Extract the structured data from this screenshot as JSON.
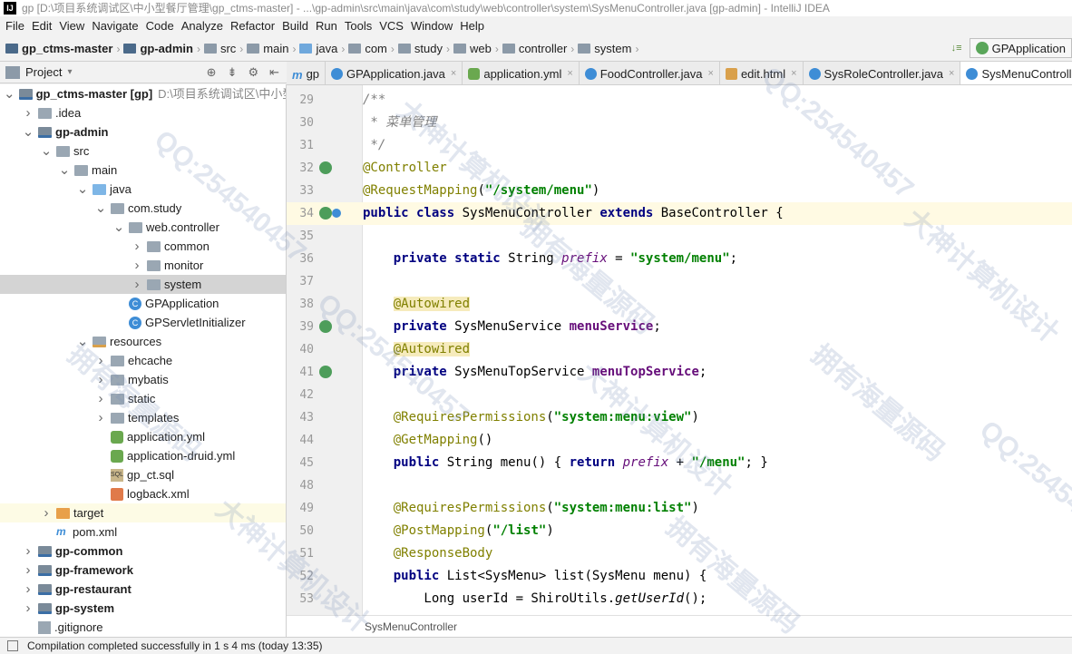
{
  "window": {
    "title": "gp [D:\\项目系统调试区\\中小型餐厅管理\\gp_ctms-master] - ...\\gp-admin\\src\\main\\java\\com\\study\\web\\controller\\system\\SysMenuController.java [gp-admin] - IntelliJ IDEA"
  },
  "menu": [
    "File",
    "Edit",
    "View",
    "Navigate",
    "Code",
    "Analyze",
    "Refactor",
    "Build",
    "Run",
    "Tools",
    "VCS",
    "Window",
    "Help"
  ],
  "breadcrumbs": [
    "gp_ctms-master",
    "gp-admin",
    "src",
    "main",
    "java",
    "com",
    "study",
    "web",
    "controller",
    "system"
  ],
  "run_config": "GPApplication",
  "project_panel": {
    "title": "Project"
  },
  "tree": [
    {
      "label": "gp_ctms-master [gp]",
      "path": "D:\\项目系统调试区\\中小型餐",
      "level": 0,
      "arrow": "▾",
      "icon": "mod",
      "bold": true
    },
    {
      "label": ".idea",
      "level": 1,
      "arrow": "▸",
      "icon": "gray"
    },
    {
      "label": "gp-admin",
      "level": 1,
      "arrow": "▾",
      "icon": "mod",
      "bold": true
    },
    {
      "label": "src",
      "level": 2,
      "arrow": "▾",
      "icon": "gray"
    },
    {
      "label": "main",
      "level": 3,
      "arrow": "▾",
      "icon": "gray"
    },
    {
      "label": "java",
      "level": 4,
      "arrow": "▾",
      "icon": "blue"
    },
    {
      "label": "com.study",
      "level": 5,
      "arrow": "▾",
      "icon": "gray"
    },
    {
      "label": "web.controller",
      "level": 6,
      "arrow": "▾",
      "icon": "gray"
    },
    {
      "label": "common",
      "level": 7,
      "arrow": "▸",
      "icon": "gray"
    },
    {
      "label": "monitor",
      "level": 7,
      "arrow": "▸",
      "icon": "gray"
    },
    {
      "label": "system",
      "level": 7,
      "arrow": "▸",
      "icon": "gray",
      "selected": true
    },
    {
      "label": "GPApplication",
      "level": 6,
      "arrow": "",
      "icon": "class"
    },
    {
      "label": "GPServletInitializer",
      "level": 6,
      "arrow": "",
      "icon": "class"
    },
    {
      "label": "resources",
      "level": 4,
      "arrow": "▾",
      "icon": "res"
    },
    {
      "label": "ehcache",
      "level": 5,
      "arrow": "▸",
      "icon": "gray"
    },
    {
      "label": "mybatis",
      "level": 5,
      "arrow": "▸",
      "icon": "gray"
    },
    {
      "label": "static",
      "level": 5,
      "arrow": "▸",
      "icon": "gray"
    },
    {
      "label": "templates",
      "level": 5,
      "arrow": "▸",
      "icon": "gray"
    },
    {
      "label": "application.yml",
      "level": 5,
      "arrow": "",
      "icon": "yml"
    },
    {
      "label": "application-druid.yml",
      "level": 5,
      "arrow": "",
      "icon": "yml"
    },
    {
      "label": "gp_ct.sql",
      "level": 5,
      "arrow": "",
      "icon": "sql"
    },
    {
      "label": "logback.xml",
      "level": 5,
      "arrow": "",
      "icon": "xml"
    },
    {
      "label": "target",
      "level": 2,
      "arrow": "▸",
      "icon": "orange",
      "highlight": true
    },
    {
      "label": "pom.xml",
      "level": 2,
      "arrow": "",
      "icon": "maven"
    },
    {
      "label": "gp-common",
      "level": 1,
      "arrow": "▸",
      "icon": "mod",
      "bold": true
    },
    {
      "label": "gp-framework",
      "level": 1,
      "arrow": "▸",
      "icon": "mod",
      "bold": true
    },
    {
      "label": "gp-restaurant",
      "level": 1,
      "arrow": "▸",
      "icon": "mod",
      "bold": true
    },
    {
      "label": "gp-system",
      "level": 1,
      "arrow": "▸",
      "icon": "mod",
      "bold": true
    },
    {
      "label": ".gitignore",
      "level": 1,
      "arrow": "",
      "icon": "file"
    }
  ],
  "tabs": [
    {
      "label": "gp",
      "icon": "m",
      "close": false
    },
    {
      "label": "GPApplication.java",
      "icon": "c",
      "close": true
    },
    {
      "label": "application.yml",
      "icon": "y",
      "close": true
    },
    {
      "label": "FoodController.java",
      "icon": "c",
      "close": true
    },
    {
      "label": "edit.html",
      "icon": "h",
      "close": true
    },
    {
      "label": "SysRoleController.java",
      "icon": "c",
      "close": true
    },
    {
      "label": "SysMenuController.java",
      "icon": "c",
      "close": true,
      "active": true
    }
  ],
  "code_lines": [
    {
      "n": "29",
      "html": "<span class=\"cmt\">/**</span>"
    },
    {
      "n": "30",
      "html": "<span class=\"cmt\"> * 菜单管理</span>"
    },
    {
      "n": "31",
      "html": "<span class=\"cmt\"> */</span>"
    },
    {
      "n": "32",
      "html": "<span class=\"ann\">@Controller</span>",
      "mark": true
    },
    {
      "n": "33",
      "html": "<span class=\"ann\">@RequestMapping</span>(<span class=\"str\">\"/system/menu\"</span>)"
    },
    {
      "n": "34",
      "html": "<span class=\"kw\">public class</span> SysMenuController <span class=\"kw\">extends</span> BaseController {",
      "mark": true,
      "mark2": true,
      "current": true
    },
    {
      "n": "35",
      "html": ""
    },
    {
      "n": "36",
      "html": "    <span class=\"kw\">private static</span> String <span class=\"italf\">prefix</span> = <span class=\"str\">\"system/menu\"</span>;"
    },
    {
      "n": "37",
      "html": ""
    },
    {
      "n": "38",
      "html": "    <span class=\"ann annbg\">@Autowired</span>"
    },
    {
      "n": "39",
      "html": "    <span class=\"kw\">private</span> SysMenuService <span class=\"fld\">menuService</span>;",
      "mark": true
    },
    {
      "n": "40",
      "html": "    <span class=\"ann annbg\">@Autowired</span>"
    },
    {
      "n": "41",
      "html": "    <span class=\"kw\">private</span> SysMenuTopService <span class=\"fld\">menuTopService</span>;",
      "mark": true
    },
    {
      "n": "42",
      "html": ""
    },
    {
      "n": "43",
      "html": "    <span class=\"ann\">@RequiresPermissions</span>(<span class=\"str\">\"system:menu:view\"</span>)"
    },
    {
      "n": "44",
      "html": "    <span class=\"ann\">@GetMapping</span>()"
    },
    {
      "n": "45",
      "html": "    <span class=\"kw\">public</span> String menu() { <span class=\"kw\">return</span> <span class=\"italf\">prefix</span> + <span class=\"str\">\"/menu\"</span>; }"
    },
    {
      "n": "48",
      "html": ""
    },
    {
      "n": "49",
      "html": "    <span class=\"ann\">@RequiresPermissions</span>(<span class=\"str\">\"system:menu:list\"</span>)"
    },
    {
      "n": "50",
      "html": "    <span class=\"ann\">@PostMapping</span>(<span class=\"str\">\"/list\"</span>)"
    },
    {
      "n": "51",
      "html": "    <span class=\"ann\">@ResponseBody</span>"
    },
    {
      "n": "52",
      "html": "    <span class=\"kw\">public</span> List&lt;SysMenu&gt; list(SysMenu menu) {"
    },
    {
      "n": "53",
      "html": "        Long userId = ShiroUtils.<span class=\"ital\">getUserId</span>();"
    }
  ],
  "editor_breadcrumb": "SysMenuController",
  "status": "Compilation completed successfully in 1 s 4 ms (today 13:35)",
  "watermarks": [
    "QQ:254540457",
    "大神计算机设计",
    "拥有海量源码",
    "QQ:254540457",
    "大神计算机设计",
    "拥有海量源码",
    "QQ:254540457",
    "大神计算机设计",
    "拥有海量源码",
    "QQ:254540457",
    "大神计算机设计",
    "拥有海量源码"
  ]
}
